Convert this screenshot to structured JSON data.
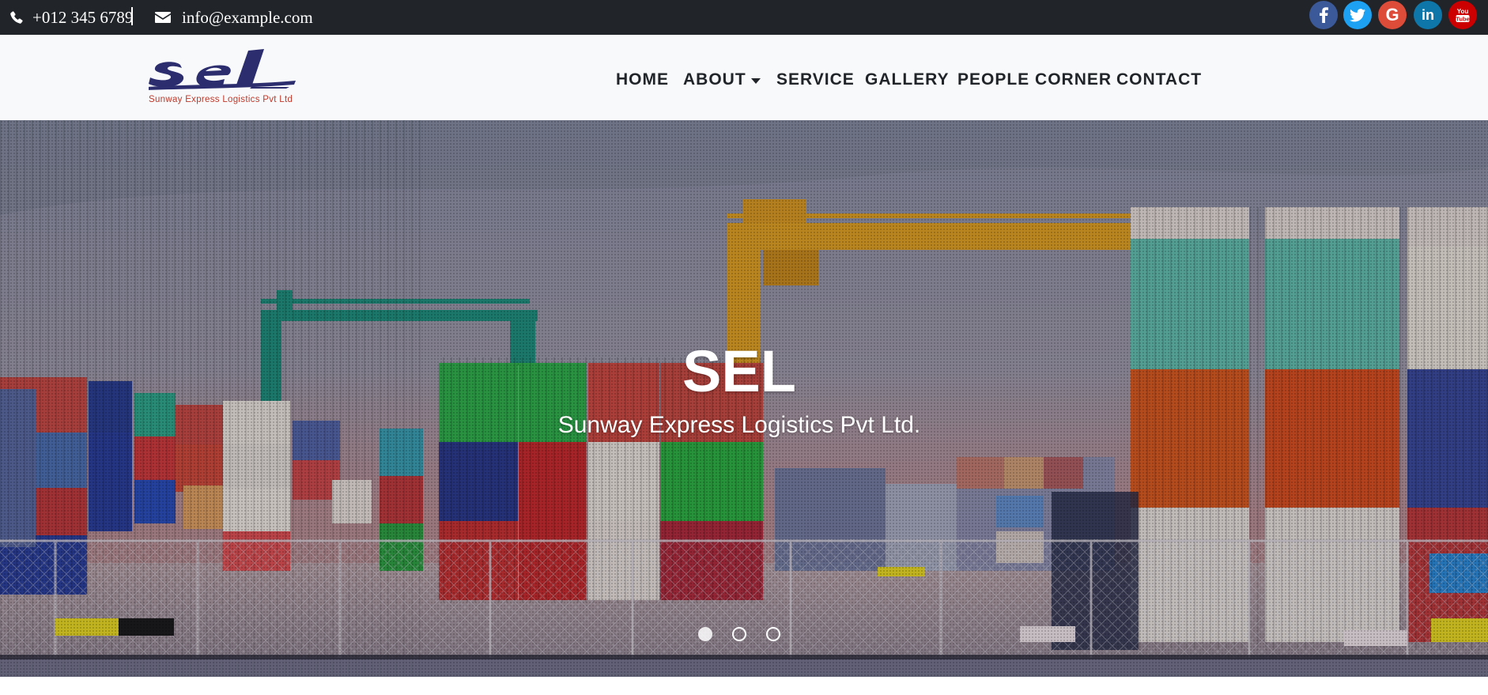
{
  "topbar": {
    "phone": "+012 345 6789",
    "email": "info@example.com",
    "icons": {
      "phone": "phone-icon",
      "email": "envelope-icon"
    },
    "social": [
      {
        "name": "facebook",
        "icon": "facebook-icon",
        "glyph": "f",
        "color": "#3b5998"
      },
      {
        "name": "twitter",
        "icon": "twitter-icon",
        "glyph": "",
        "color": "#1da1f2"
      },
      {
        "name": "google",
        "icon": "google-icon",
        "glyph": "G",
        "color": "#dd4b39"
      },
      {
        "name": "linkedin",
        "icon": "linkedin-icon",
        "glyph": "in",
        "color": "#0e76a8"
      },
      {
        "name": "youtube",
        "icon": "youtube-icon",
        "glyph": "You",
        "color": "#cc0000"
      }
    ],
    "background": "#212529"
  },
  "brand": {
    "logo_text": "sel",
    "tagline": "Sunway Express Logistics Pvt Ltd",
    "logo_color": "#2b2d6e",
    "tagline_color": "#c0392b"
  },
  "nav": {
    "items": [
      {
        "label": "HOME"
      },
      {
        "label": "ABOUT",
        "has_dropdown": true
      },
      {
        "label": "SERVICE"
      },
      {
        "label": "GALLERY"
      },
      {
        "label": "PEOPLE CORNER"
      },
      {
        "label": "CONTACT"
      }
    ],
    "background": "#f8f9fa"
  },
  "hero": {
    "title": "SEL",
    "subtitle": "Sunway Express Logistics Pvt Ltd.",
    "image": "shipping-container-port-photo",
    "slides": 3,
    "active_slide": 1
  }
}
